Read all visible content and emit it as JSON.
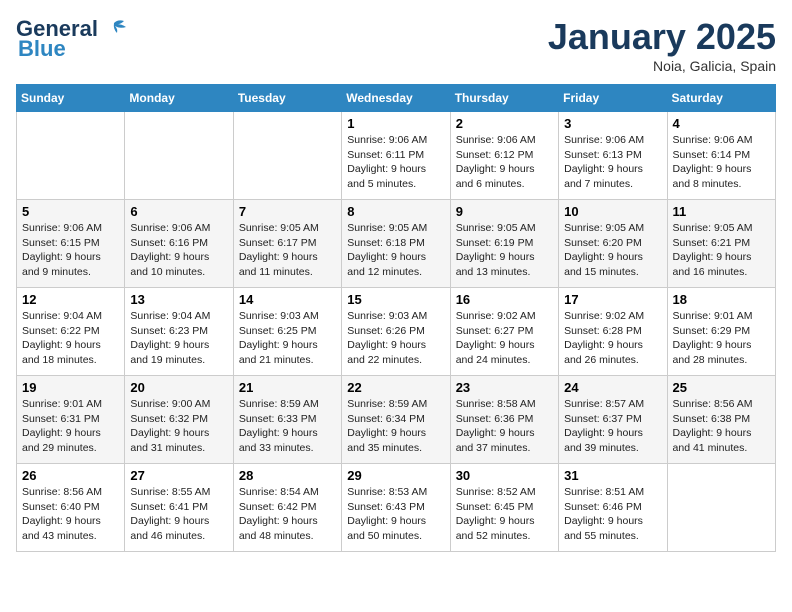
{
  "logo": {
    "line1": "General",
    "line2": "Blue"
  },
  "title": "January 2025",
  "location": "Noia, Galicia, Spain",
  "weekdays": [
    "Sunday",
    "Monday",
    "Tuesday",
    "Wednesday",
    "Thursday",
    "Friday",
    "Saturday"
  ],
  "weeks": [
    [
      {
        "day": "",
        "info": ""
      },
      {
        "day": "",
        "info": ""
      },
      {
        "day": "",
        "info": ""
      },
      {
        "day": "1",
        "info": "Sunrise: 9:06 AM\nSunset: 6:11 PM\nDaylight: 9 hours\nand 5 minutes."
      },
      {
        "day": "2",
        "info": "Sunrise: 9:06 AM\nSunset: 6:12 PM\nDaylight: 9 hours\nand 6 minutes."
      },
      {
        "day": "3",
        "info": "Sunrise: 9:06 AM\nSunset: 6:13 PM\nDaylight: 9 hours\nand 7 minutes."
      },
      {
        "day": "4",
        "info": "Sunrise: 9:06 AM\nSunset: 6:14 PM\nDaylight: 9 hours\nand 8 minutes."
      }
    ],
    [
      {
        "day": "5",
        "info": "Sunrise: 9:06 AM\nSunset: 6:15 PM\nDaylight: 9 hours\nand 9 minutes."
      },
      {
        "day": "6",
        "info": "Sunrise: 9:06 AM\nSunset: 6:16 PM\nDaylight: 9 hours\nand 10 minutes."
      },
      {
        "day": "7",
        "info": "Sunrise: 9:05 AM\nSunset: 6:17 PM\nDaylight: 9 hours\nand 11 minutes."
      },
      {
        "day": "8",
        "info": "Sunrise: 9:05 AM\nSunset: 6:18 PM\nDaylight: 9 hours\nand 12 minutes."
      },
      {
        "day": "9",
        "info": "Sunrise: 9:05 AM\nSunset: 6:19 PM\nDaylight: 9 hours\nand 13 minutes."
      },
      {
        "day": "10",
        "info": "Sunrise: 9:05 AM\nSunset: 6:20 PM\nDaylight: 9 hours\nand 15 minutes."
      },
      {
        "day": "11",
        "info": "Sunrise: 9:05 AM\nSunset: 6:21 PM\nDaylight: 9 hours\nand 16 minutes."
      }
    ],
    [
      {
        "day": "12",
        "info": "Sunrise: 9:04 AM\nSunset: 6:22 PM\nDaylight: 9 hours\nand 18 minutes."
      },
      {
        "day": "13",
        "info": "Sunrise: 9:04 AM\nSunset: 6:23 PM\nDaylight: 9 hours\nand 19 minutes."
      },
      {
        "day": "14",
        "info": "Sunrise: 9:03 AM\nSunset: 6:25 PM\nDaylight: 9 hours\nand 21 minutes."
      },
      {
        "day": "15",
        "info": "Sunrise: 9:03 AM\nSunset: 6:26 PM\nDaylight: 9 hours\nand 22 minutes."
      },
      {
        "day": "16",
        "info": "Sunrise: 9:02 AM\nSunset: 6:27 PM\nDaylight: 9 hours\nand 24 minutes."
      },
      {
        "day": "17",
        "info": "Sunrise: 9:02 AM\nSunset: 6:28 PM\nDaylight: 9 hours\nand 26 minutes."
      },
      {
        "day": "18",
        "info": "Sunrise: 9:01 AM\nSunset: 6:29 PM\nDaylight: 9 hours\nand 28 minutes."
      }
    ],
    [
      {
        "day": "19",
        "info": "Sunrise: 9:01 AM\nSunset: 6:31 PM\nDaylight: 9 hours\nand 29 minutes."
      },
      {
        "day": "20",
        "info": "Sunrise: 9:00 AM\nSunset: 6:32 PM\nDaylight: 9 hours\nand 31 minutes."
      },
      {
        "day": "21",
        "info": "Sunrise: 8:59 AM\nSunset: 6:33 PM\nDaylight: 9 hours\nand 33 minutes."
      },
      {
        "day": "22",
        "info": "Sunrise: 8:59 AM\nSunset: 6:34 PM\nDaylight: 9 hours\nand 35 minutes."
      },
      {
        "day": "23",
        "info": "Sunrise: 8:58 AM\nSunset: 6:36 PM\nDaylight: 9 hours\nand 37 minutes."
      },
      {
        "day": "24",
        "info": "Sunrise: 8:57 AM\nSunset: 6:37 PM\nDaylight: 9 hours\nand 39 minutes."
      },
      {
        "day": "25",
        "info": "Sunrise: 8:56 AM\nSunset: 6:38 PM\nDaylight: 9 hours\nand 41 minutes."
      }
    ],
    [
      {
        "day": "26",
        "info": "Sunrise: 8:56 AM\nSunset: 6:40 PM\nDaylight: 9 hours\nand 43 minutes."
      },
      {
        "day": "27",
        "info": "Sunrise: 8:55 AM\nSunset: 6:41 PM\nDaylight: 9 hours\nand 46 minutes."
      },
      {
        "day": "28",
        "info": "Sunrise: 8:54 AM\nSunset: 6:42 PM\nDaylight: 9 hours\nand 48 minutes."
      },
      {
        "day": "29",
        "info": "Sunrise: 8:53 AM\nSunset: 6:43 PM\nDaylight: 9 hours\nand 50 minutes."
      },
      {
        "day": "30",
        "info": "Sunrise: 8:52 AM\nSunset: 6:45 PM\nDaylight: 9 hours\nand 52 minutes."
      },
      {
        "day": "31",
        "info": "Sunrise: 8:51 AM\nSunset: 6:46 PM\nDaylight: 9 hours\nand 55 minutes."
      },
      {
        "day": "",
        "info": ""
      }
    ]
  ]
}
